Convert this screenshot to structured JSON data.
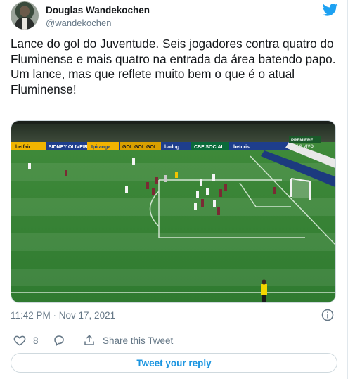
{
  "author": {
    "name": "Douglas Wandekochen",
    "handle": "@wandekochen",
    "avatar_icon": "profile-photo"
  },
  "brand_icon": "twitter-bird-icon",
  "brand_color": "#1da1f2",
  "tweet": {
    "paragraphs": [
      "Lance do gol do Juventude. Seis jogadores contra quatro do Fluminense e mais quatro na entrada da área batendo papo.",
      "Um lance, mas que reflete muito bem o que é o atual Fluminense!"
    ]
  },
  "media": {
    "ads": [
      "betfair",
      "SIDNEY OLIVEIRA",
      "Ipiranga",
      "GOL GOL GOL",
      "badog",
      "CBF SOCIAL",
      "betcris",
      "PREMIERE",
      "AO VIVO"
    ]
  },
  "timestamp": "11:42 PM · Nov 17, 2021",
  "actions": {
    "like_count": "8",
    "share_label": "Share this Tweet"
  },
  "reply_button_label": "Tweet your reply",
  "accent_color": "#1b95e0"
}
